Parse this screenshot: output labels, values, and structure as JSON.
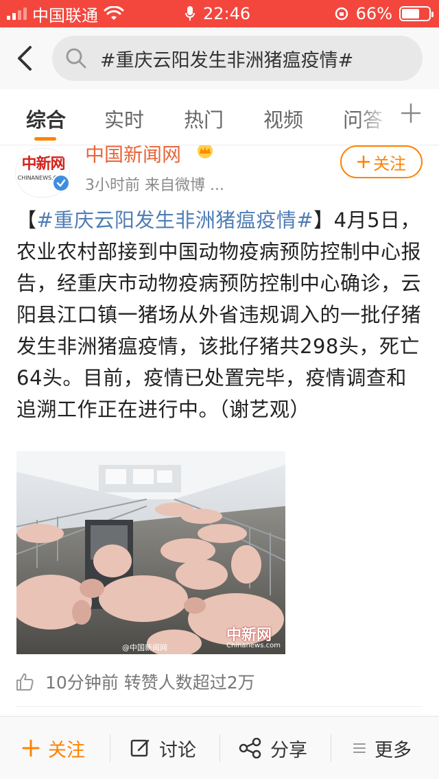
{
  "status_bar": {
    "carrier": "中国联通",
    "time": "22:46",
    "battery": "66%"
  },
  "search": {
    "query": "#重庆云阳发生非洲猪瘟疫情#"
  },
  "tabs": [
    {
      "label": "综合",
      "active": true
    },
    {
      "label": "实时",
      "active": false
    },
    {
      "label": "热门",
      "active": false
    },
    {
      "label": "视频",
      "active": false
    },
    {
      "label": "问答",
      "active": false
    }
  ],
  "post": {
    "author": "中国新闻网",
    "avatar_text": "中新网",
    "avatar_subtext": "CHINANEWS.COM",
    "meta": "3小时前  来自微博 ...",
    "follow_label": "关注",
    "topic": "#重庆云阳发生非洲猪瘟疫情#",
    "body": "4月5日，农业农村部接到中国动物疫病预防控制中心报告，经重庆市动物疫病预防控制中心确诊，云阳县江口镇一猪场从外省违规调入的一批仔猪发生非洲猪瘟疫情，该批仔猪共298头，死亡64头。目前，疫情已处置完毕，疫情调查和追溯工作正在进行中。（谢艺观）",
    "image_watermark": "@中国新闻网",
    "image_logo": "中新网",
    "image_site": "Chinanews.com",
    "likes_text": "10分钟前 转赞人数超过2万"
  },
  "bottom_bar": {
    "follow": "关注",
    "comment": "讨论",
    "share": "分享",
    "more": "更多"
  },
  "colors": {
    "status_bar": "#f3473d",
    "accent": "#ff8200",
    "topic_link": "#4f7db5",
    "author_name": "#e8653a"
  }
}
